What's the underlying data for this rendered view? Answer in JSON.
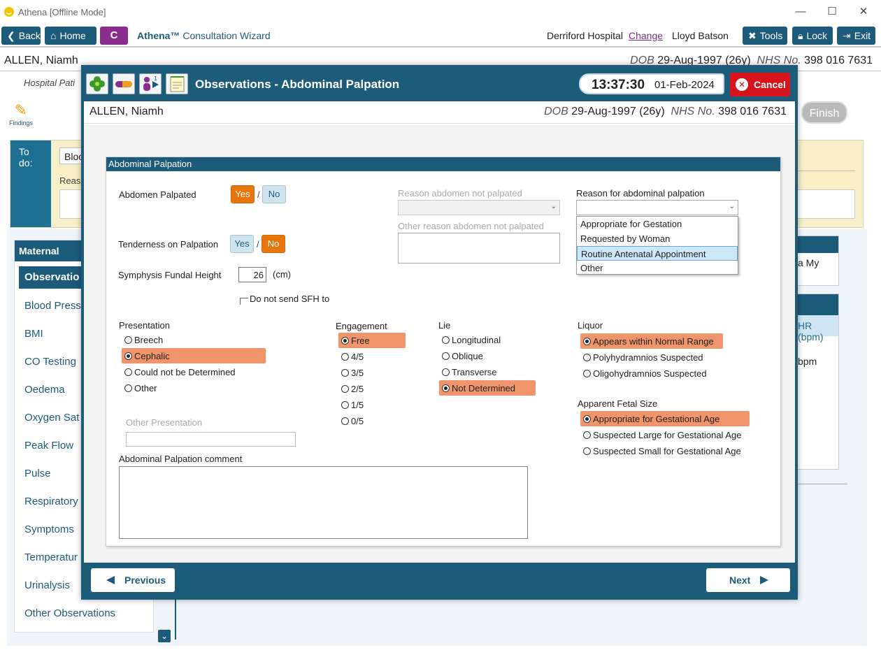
{
  "window": {
    "title": "Athena [Offline Mode]",
    "minimize": "—",
    "maximize": "☐",
    "close": "✕"
  },
  "toolbar": {
    "back": "Back",
    "home": "Home",
    "c_button": "C",
    "app_brand": "Athena™",
    "wizard_name": "Consultation Wizard",
    "hospital": "Derriford Hospital",
    "change": "Change",
    "user": "Lloyd Batson",
    "tools": "Tools",
    "lock": "Lock",
    "exit": "Exit"
  },
  "background": {
    "patient_name": "ALLEN, Niamh",
    "dob_label": "DOB",
    "dob": "29-Aug-1997 (26y)",
    "nhs_label": "NHS No.",
    "nhs": "398 016 7631",
    "hospital_partial": "Hospital Pati",
    "findings": "Findings",
    "finish": "Finish",
    "todo_label": "To do:",
    "todo_blood": "Bloo",
    "todo_reason": "Reaso",
    "sidebar_header": "Maternal",
    "sidebar_items": [
      "Observatio",
      "Blood Press",
      "BMI",
      "CO Testing",
      "Oedema",
      "Oxygen Sat",
      "Peak Flow",
      "Pulse",
      "Respiratory",
      "Symptoms",
      "Temperatur",
      "Urinalysis",
      "Other Observations"
    ],
    "right_text1": "a My",
    "right_sub": "HR (bpm)",
    "right_text2": "bpm"
  },
  "modal": {
    "title": "Observations - Abdominal Palpation",
    "time": "13:37:30",
    "date": "01-Feb-2024",
    "cancel": "Cancel",
    "patient_name": "ALLEN, Niamh",
    "dob_label": "DOB",
    "dob": "29-Aug-1997 (26y)",
    "nhs_label": "NHS No.",
    "nhs": "398 016 7631",
    "previous": "Previous",
    "next": "Next"
  },
  "panel": {
    "header": "Abdominal Palpation",
    "abdomen_palpated_label": "Abdomen Palpated",
    "yes": "Yes",
    "no": "No",
    "slash": "/",
    "abdomen_palpated": "Yes",
    "tenderness_label": "Tenderness on Palpation",
    "tenderness": "No",
    "reason_not_palpated_label": "Reason abdomen not palpated",
    "other_reason_not_palpated_label": "Other reason abdomen not palpated",
    "reason_palpation_label": "Reason for abdominal palpation",
    "reason_options": [
      "Appropriate for Gestation",
      "Requested by Woman",
      "Routine Antenatal Appointment",
      "Other"
    ],
    "reason_highlighted": "Routine Antenatal Appointment",
    "sfh_label": "Symphysis Fundal Height",
    "sfh_value": "26",
    "sfh_unit": "(cm)",
    "do_not_send_label": "Do not send SFH to",
    "presentation_label": "Presentation",
    "presentation_options": [
      "Breech",
      "Cephalic",
      "Could not be Determined",
      "Other"
    ],
    "presentation_selected": "Cephalic",
    "other_presentation_label": "Other Presentation",
    "engagement_label": "Engagement",
    "engagement_options": [
      "Free",
      "4/5",
      "3/5",
      "2/5",
      "1/5",
      "0/5"
    ],
    "engagement_selected": "Free",
    "lie_label": "Lie",
    "lie_options": [
      "Longitudinal",
      "Oblique",
      "Transverse",
      "Not Determined"
    ],
    "lie_selected": "Not Determined",
    "liquor_label": "Liquor",
    "liquor_options": [
      "Appears within Normal Range",
      "Polyhydramnios Suspected",
      "Oligohydramnios Suspected"
    ],
    "liquor_selected": "Appears within Normal Range",
    "fetal_size_label": "Apparent Fetal Size",
    "fetal_size_options": [
      "Appropriate for Gestational Age",
      "Suspected Large for Gestational Age",
      "Suspected Small for Gestational Age"
    ],
    "fetal_size_selected": "Appropriate for Gestational Age",
    "comment_label": "Abdominal Palpation comment"
  },
  "colors": {
    "primary": "#1d5b7a",
    "selected": "#f0956b",
    "toggle_on": "#e9750b",
    "cancel": "#d7141c",
    "c_button": "#8a2d8e"
  }
}
